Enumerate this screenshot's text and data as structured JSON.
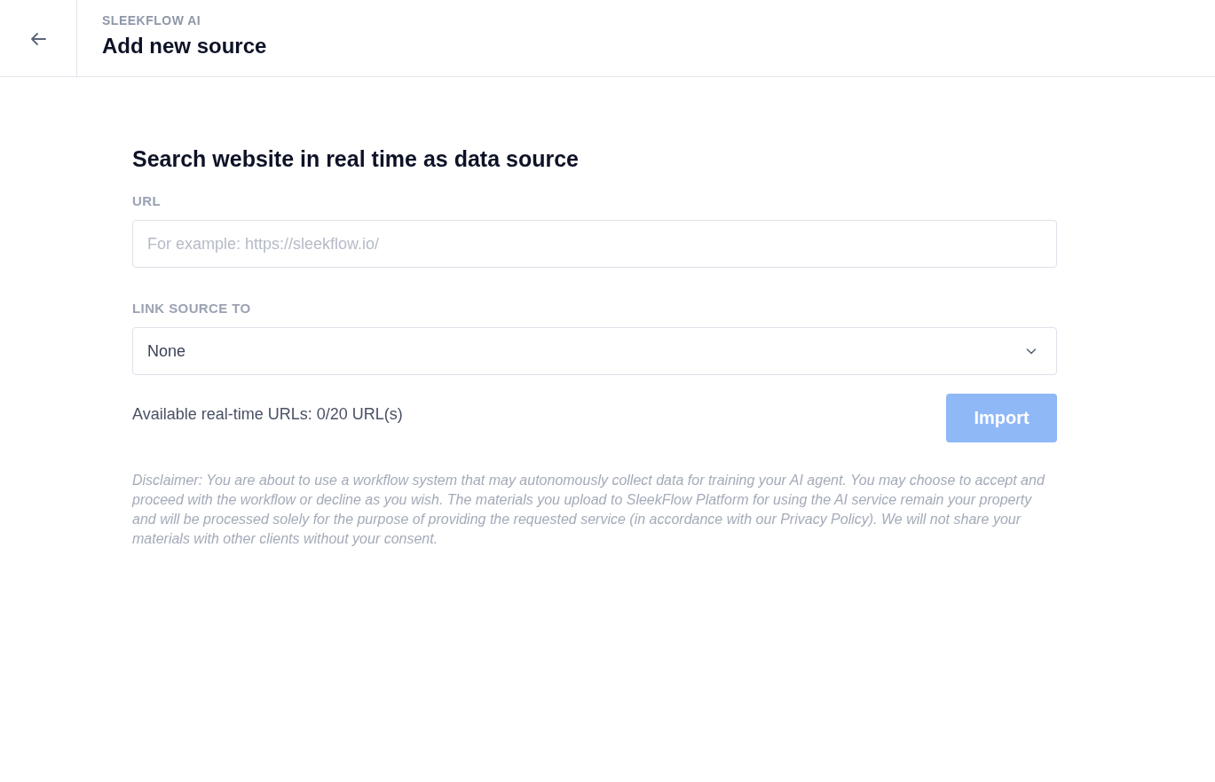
{
  "header": {
    "eyebrow": "SLEEKFLOW AI",
    "title": "Add new source"
  },
  "form": {
    "heading": "Search website in real time as data source",
    "url": {
      "label": "URL",
      "placeholder": "For example: https://sleekflow.io/"
    },
    "link_source": {
      "label": "LINK SOURCE TO",
      "value": "None"
    },
    "availability": "Available real-time URLs: 0/20 URL(s)",
    "import_button": {
      "label": "Import",
      "disabled": true
    },
    "disclaimer": "Disclaimer: You are about to use a workflow system that may autonomously collect data for training your AI agent. You may choose to accept and proceed with the workflow or decline as you wish. The materials you upload to SleekFlow Platform for using the AI service remain your property and will be processed solely for the purpose of providing the requested service (in accordance with our Privacy Policy). We will not share your materials with other clients without your consent."
  }
}
